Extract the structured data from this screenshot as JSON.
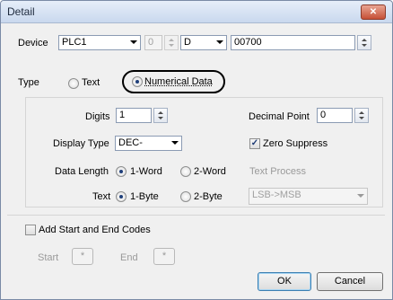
{
  "window": {
    "title": "Detail",
    "close_glyph": "✕"
  },
  "device": {
    "label": "Device",
    "plc": "PLC1",
    "station": "0",
    "type": "D",
    "address": "00700"
  },
  "type_row": {
    "label": "Type",
    "text_option": "Text",
    "numerical_option": "Numerical Data",
    "selected": "Numerical Data"
  },
  "numeric": {
    "digits_label": "Digits",
    "digits_value": "1",
    "decimal_point_label": "Decimal Point",
    "decimal_point_value": "0",
    "display_type_label": "Display Type",
    "display_type_value": "DEC-",
    "zero_suppress_label": "Zero Suppress",
    "zero_suppress_checked": true,
    "data_length_label": "Data Length",
    "one_word": "1-Word",
    "two_word": "2-Word",
    "text_process_label": "Text Process",
    "text_label": "Text",
    "one_byte": "1-Byte",
    "two_byte": "2-Byte",
    "text_process_value": "LSB->MSB"
  },
  "codes": {
    "checkbox_label": "Add Start and End Codes",
    "start_label": "Start",
    "start_button": "*",
    "end_label": "End",
    "end_button": "*"
  },
  "buttons": {
    "ok": "OK",
    "cancel": "Cancel"
  },
  "colors": {
    "title_gradient_top": "#e6eef9",
    "accent": "#3c7fb1",
    "close": "#c65036"
  }
}
